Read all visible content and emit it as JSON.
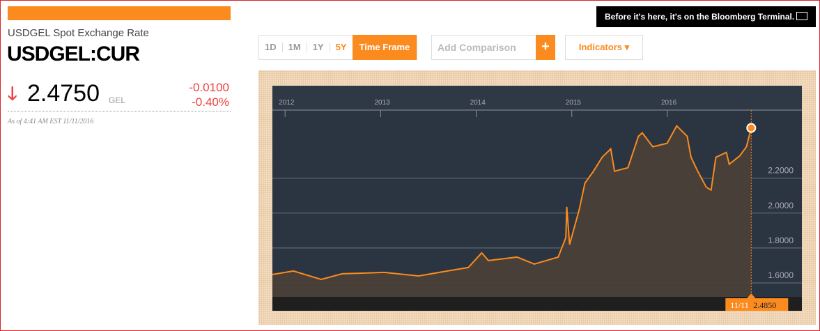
{
  "header": {
    "name": "USDGEL Spot Exchange Rate",
    "ticker": "USDGEL:CUR",
    "price": "2.4750",
    "currency": "GEL",
    "change": "-0.0100",
    "change_pct": "-0.40%",
    "as_of": "As of 4:41 AM EST 11/11/2016",
    "direction_icon": "arrow-down-icon"
  },
  "promo": {
    "text": "Before it's here, it's on the Bloomberg Terminal.",
    "icon": "terminal-icon"
  },
  "controls": {
    "ranges": [
      "1D",
      "1M",
      "1Y",
      "5Y"
    ],
    "active_range": "5Y",
    "time_frame": "Time Frame",
    "add_comparison": "Add Comparison",
    "add_icon": "+",
    "indicators": "Indicators ▾"
  },
  "colors": {
    "accent": "#fb8b1e",
    "negative": "#ef3d3d",
    "chart_bg": "#2b3441"
  },
  "chart_data": {
    "type": "area",
    "title": "USDGEL 5Y",
    "xlabel": "",
    "ylabel": "",
    "x_ticks": [
      "2012",
      "2013",
      "2014",
      "2015",
      "2016"
    ],
    "y_ticks": [
      "1.6000",
      "1.8000",
      "2.0000",
      "2.2000"
    ],
    "xlim": [
      2011.86,
      2017.4
    ],
    "ylim": [
      1.52,
      2.73
    ],
    "x": [
      2011.86,
      2012.08,
      2012.37,
      2012.59,
      2013.03,
      2013.39,
      2013.69,
      2013.91,
      2014.05,
      2014.12,
      2014.42,
      2014.6,
      2014.85,
      2014.93,
      2014.94,
      2014.97,
      2015.07,
      2015.13,
      2015.22,
      2015.31,
      2015.4,
      2015.44,
      2015.58,
      2015.69,
      2015.73,
      2015.84,
      2015.99,
      2016.09,
      2016.2,
      2016.24,
      2016.31,
      2016.4,
      2016.45,
      2016.5,
      2016.61,
      2016.64,
      2016.75,
      2016.82,
      2016.87
    ],
    "values": [
      1.648,
      1.668,
      1.62,
      1.652,
      1.66,
      1.64,
      1.668,
      1.688,
      1.772,
      1.728,
      1.748,
      1.708,
      1.748,
      1.86,
      2.036,
      1.82,
      2.02,
      2.172,
      2.24,
      2.32,
      2.368,
      2.24,
      2.26,
      2.44,
      2.46,
      2.38,
      2.4,
      2.5,
      2.44,
      2.32,
      2.24,
      2.148,
      2.132,
      2.32,
      2.348,
      2.28,
      2.328,
      2.38,
      2.488
    ],
    "tooltip": {
      "date": "11/11",
      "value": "2.4850"
    }
  }
}
